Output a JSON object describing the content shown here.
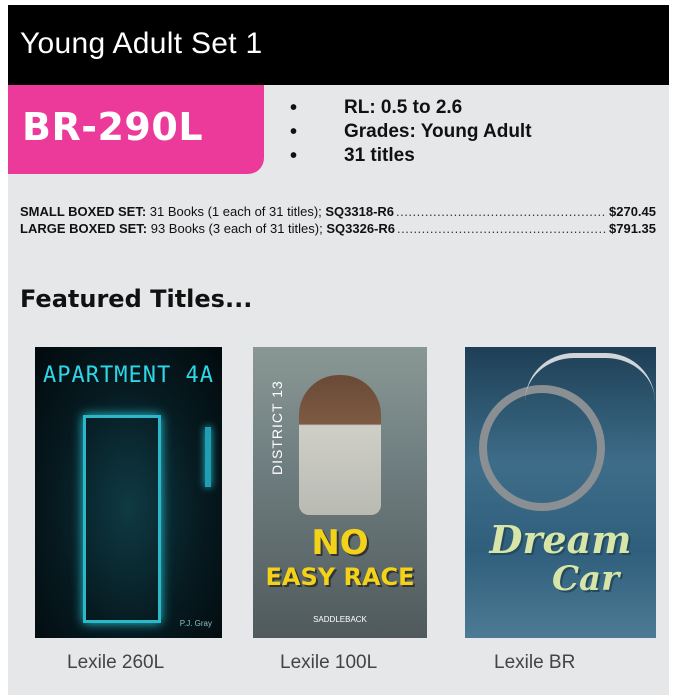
{
  "header": {
    "title": "Young Adult Set 1"
  },
  "badge": {
    "level": "BR-290L"
  },
  "bullets": [
    "RL: 0.5 to 2.6",
    "Grades: Young Adult",
    "31 titles"
  ],
  "sets": [
    {
      "lead": "SMALL BOXED SET:",
      "desc": " 31 Books (1 each of 31 titles); ",
      "code": "SQ3318-R6",
      "leader": "....................................................................................................",
      "price": "$270.45"
    },
    {
      "lead": "LARGE BOXED SET:",
      "desc": " 93 Books (3 each of 31 titles); ",
      "code": "SQ3326-R6",
      "leader": "....................................................................................................",
      "price": "$791.35"
    }
  ],
  "featured": {
    "heading": "Featured Titles..."
  },
  "books": [
    {
      "cover_title": "APARTMENT 4A",
      "cover_author": "P.J. Gray",
      "caption": "Lexile 260L"
    },
    {
      "cover_series": "DISTRICT 13",
      "cover_title_1": "NO",
      "cover_title_2": "EASY RACE",
      "cover_publisher": "SADDLEBACK",
      "caption": "Lexile 100L"
    },
    {
      "cover_title_1": "Dream",
      "cover_title_2": "Car",
      "caption": "Lexile BR"
    }
  ],
  "colors": {
    "badge": "#ec3a9b",
    "header": "#000000",
    "panel": "#e6e7e8"
  }
}
